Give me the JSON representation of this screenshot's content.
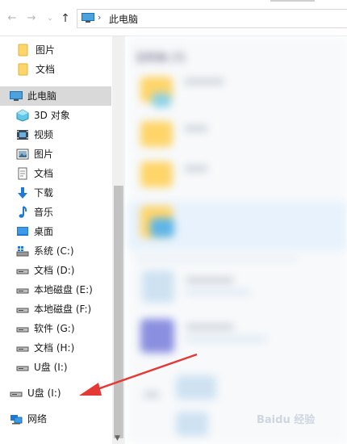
{
  "address_bar": {
    "breadcrumb": "此电脑"
  },
  "content_header": "文件夹 (7)",
  "sidebar": {
    "items": [
      {
        "label": "图片",
        "icon": "folder-icon"
      },
      {
        "label": "文档",
        "icon": "folder-icon"
      },
      {
        "label": "此电脑",
        "icon": "computer-icon"
      },
      {
        "label": "3D 对象",
        "icon": "3d-objects-icon"
      },
      {
        "label": "视频",
        "icon": "video-icon"
      },
      {
        "label": "图片",
        "icon": "pictures-icon"
      },
      {
        "label": "文档",
        "icon": "documents-icon"
      },
      {
        "label": "下载",
        "icon": "download-icon"
      },
      {
        "label": "音乐",
        "icon": "music-icon"
      },
      {
        "label": "桌面",
        "icon": "desktop-icon"
      },
      {
        "label": "系统 (C:)",
        "icon": "system-drive-icon"
      },
      {
        "label": "文档 (D:)",
        "icon": "drive-icon"
      },
      {
        "label": "本地磁盘 (E:)",
        "icon": "drive-icon"
      },
      {
        "label": "本地磁盘 (F:)",
        "icon": "drive-icon"
      },
      {
        "label": "软件 (G:)",
        "icon": "drive-icon"
      },
      {
        "label": "文档 (H:)",
        "icon": "drive-icon"
      },
      {
        "label": "U盘 (I:)",
        "icon": "usb-drive-icon"
      },
      {
        "label": "U盘 (I:)",
        "icon": "usb-drive-icon"
      },
      {
        "label": "网络",
        "icon": "network-icon"
      }
    ]
  },
  "colors": {
    "selection": "#d9d9d9",
    "annotation_arrow": "#e53935",
    "folder": "#ffd56a"
  },
  "watermark": {
    "text": "Baidu 经验"
  }
}
